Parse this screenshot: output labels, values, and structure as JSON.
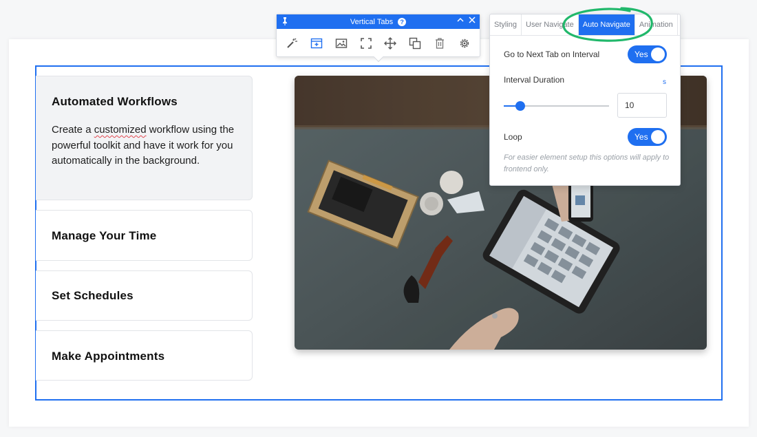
{
  "tabs": [
    {
      "title": "Automated Workflows",
      "desc_before": "Create a ",
      "desc_underlined": "customized",
      "desc_after": " workflow using the powerful toolkit and have it work for you automatically in the background."
    },
    {
      "title": "Manage Your Time"
    },
    {
      "title": "Set Schedules"
    },
    {
      "title": "Make Appointments"
    }
  ],
  "toolbar": {
    "title": "Vertical Tabs",
    "help": "?",
    "tools": [
      "magic-wand-icon",
      "add-tab-icon",
      "image-icon",
      "fullscreen-icon",
      "move-icon",
      "duplicate-icon",
      "trash-icon",
      "gear-icon"
    ]
  },
  "settings": {
    "tabs": [
      {
        "label": "Styling",
        "active": false
      },
      {
        "label": "User Navigate",
        "active": false
      },
      {
        "label": "Auto Navigate",
        "active": true
      },
      {
        "label": "Animation",
        "active": false
      }
    ],
    "next_tab_label": "Go to Next Tab on Interval",
    "next_tab_value": "Yes",
    "interval_label": "Interval Duration",
    "interval_unit": "s",
    "interval_value": "10",
    "interval_slider_fraction": 0.16,
    "loop_label": "Loop",
    "loop_value": "Yes",
    "note": "For easier element setup this options will apply to frontend only."
  },
  "colors": {
    "accent": "#1f6ff0",
    "highlight_circle": "#21b86b"
  }
}
